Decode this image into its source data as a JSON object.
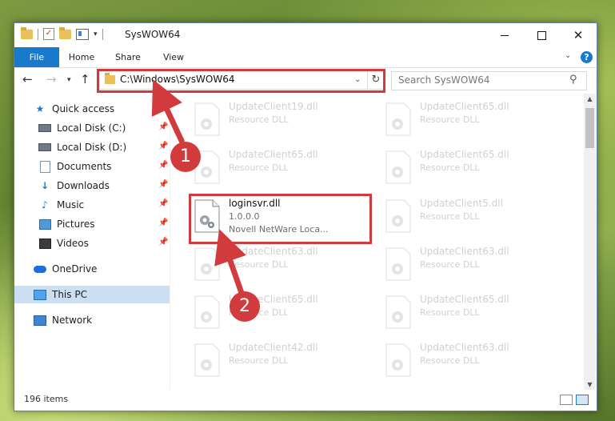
{
  "window": {
    "title": "SysWOW64"
  },
  "ribbon": {
    "tabs": [
      "File",
      "Home",
      "Share",
      "View"
    ],
    "help": "?"
  },
  "navbar": {
    "address": "C:\\Windows\\SysWOW64",
    "search_placeholder": "Search SysWOW64"
  },
  "sidebar": {
    "items": [
      {
        "label": "Quick access",
        "icon": "star-icon"
      },
      {
        "label": "Local Disk (C:)",
        "icon": "drive-icon"
      },
      {
        "label": "Local Disk (D:)",
        "icon": "drive-icon"
      },
      {
        "label": "Documents",
        "icon": "document-icon"
      },
      {
        "label": "Downloads",
        "icon": "download-icon"
      },
      {
        "label": "Music",
        "icon": "music-icon"
      },
      {
        "label": "Pictures",
        "icon": "pictures-icon"
      },
      {
        "label": "Videos",
        "icon": "video-icon"
      },
      {
        "label": "OneDrive",
        "icon": "cloud-icon"
      },
      {
        "label": "This PC",
        "icon": "computer-icon"
      },
      {
        "label": "Network",
        "icon": "network-icon"
      }
    ]
  },
  "files": [
    {
      "name": "UpdateClient19.dll",
      "line2": "Resource DLL",
      "faded": true
    },
    {
      "name": "UpdateClient65.dll",
      "line2": "Resource DLL",
      "faded": true
    },
    {
      "name": "UpdateClient65.dll",
      "line2": "Resource DLL",
      "faded": true
    },
    {
      "name": "UpdateClient65.dll",
      "line2": "Resource DLL",
      "faded": true
    },
    {
      "name": "loginsvr.dll",
      "line2": "1.0.0.0",
      "line3": "Novell NetWare Loca...",
      "faded": false
    },
    {
      "name": "UpdateClient5.dll",
      "line2": "Resource DLL",
      "faded": true
    },
    {
      "name": "UpdateClient63.dll",
      "line2": "Resource DLL",
      "faded": true
    },
    {
      "name": "UpdateClient63.dll",
      "line2": "Resource DLL",
      "faded": true
    },
    {
      "name": "UpdateClient65.dll",
      "line2": "Resource DLL",
      "faded": true
    },
    {
      "name": "UpdateClient65.dll",
      "line2": "Resource DLL",
      "faded": true
    },
    {
      "name": "UpdateClient42.dll",
      "line2": "Resource DLL",
      "faded": true
    },
    {
      "name": "UpdateClient63.dll",
      "line2": "Resource DLL",
      "faded": true
    }
  ],
  "status": {
    "item_count": "196 items"
  },
  "callouts": [
    "1",
    "2"
  ],
  "colors": {
    "accent": "#1979ca",
    "highlight": "#d23b3e",
    "selection": "#ccdef2"
  }
}
